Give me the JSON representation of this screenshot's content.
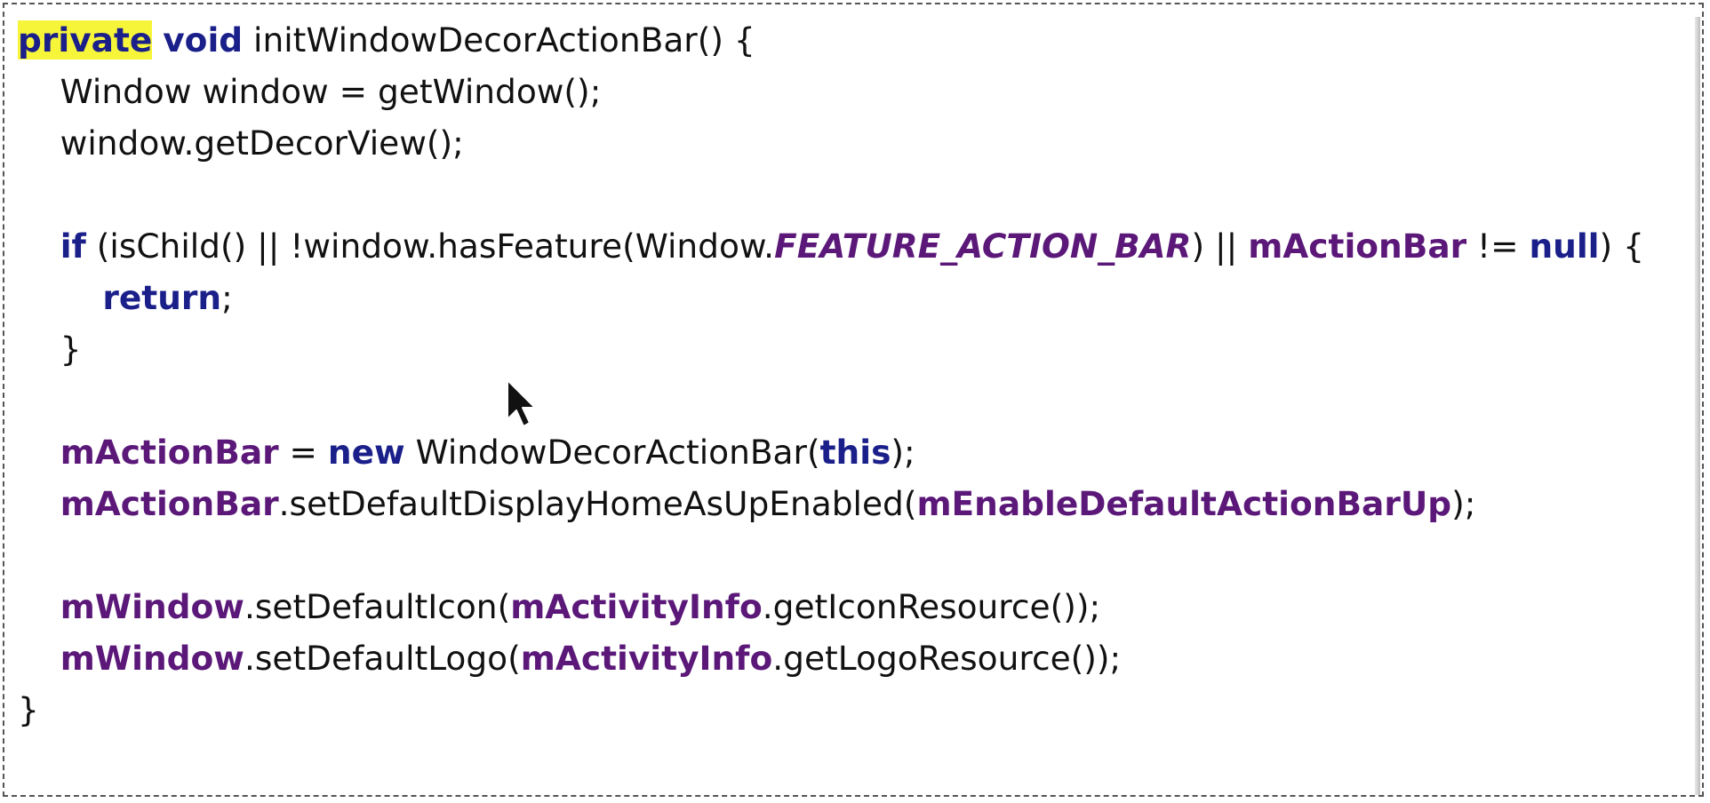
{
  "code": {
    "lines": [
      [
        {
          "t": "private",
          "k": "kw hl"
        },
        {
          "t": " "
        },
        {
          "t": "void",
          "k": "kw"
        },
        {
          "t": " initWindowDecorActionBar() {"
        }
      ],
      [
        {
          "t": "    Window window = getWindow();"
        }
      ],
      [
        {
          "t": "    window.getDecorView();"
        }
      ],
      [],
      [
        {
          "t": "    "
        },
        {
          "t": "if",
          "k": "kw"
        },
        {
          "t": " (isChild() || !window.hasFeature(Window."
        },
        {
          "t": "FEATURE_ACTION_BAR",
          "k": "static"
        },
        {
          "t": ") || "
        },
        {
          "t": "mActionBar",
          "k": "field"
        },
        {
          "t": " != "
        },
        {
          "t": "null",
          "k": "kw"
        },
        {
          "t": ") {"
        }
      ],
      [
        {
          "t": "        "
        },
        {
          "t": "return",
          "k": "kw"
        },
        {
          "t": ";"
        }
      ],
      [
        {
          "t": "    }"
        }
      ],
      [],
      [
        {
          "t": "    "
        },
        {
          "t": "mActionBar",
          "k": "field"
        },
        {
          "t": " = "
        },
        {
          "t": "new",
          "k": "kw"
        },
        {
          "t": " WindowDecorActionBar("
        },
        {
          "t": "this",
          "k": "kw"
        },
        {
          "t": ");"
        }
      ],
      [
        {
          "t": "    "
        },
        {
          "t": "mActionBar",
          "k": "field"
        },
        {
          "t": ".setDefaultDisplayHomeAsUpEnabled("
        },
        {
          "t": "mEnableDefaultActionBarUp",
          "k": "field"
        },
        {
          "t": ");"
        }
      ],
      [],
      [
        {
          "t": "    "
        },
        {
          "t": "mWindow",
          "k": "field"
        },
        {
          "t": ".setDefaultIcon("
        },
        {
          "t": "mActivityInfo",
          "k": "field"
        },
        {
          "t": ".getIconResource());"
        }
      ],
      [
        {
          "t": "    "
        },
        {
          "t": "mWindow",
          "k": "field"
        },
        {
          "t": ".setDefaultLogo("
        },
        {
          "t": "mActivityInfo",
          "k": "field"
        },
        {
          "t": ".getLogoResource());"
        }
      ],
      [
        {
          "t": "}"
        }
      ]
    ]
  }
}
